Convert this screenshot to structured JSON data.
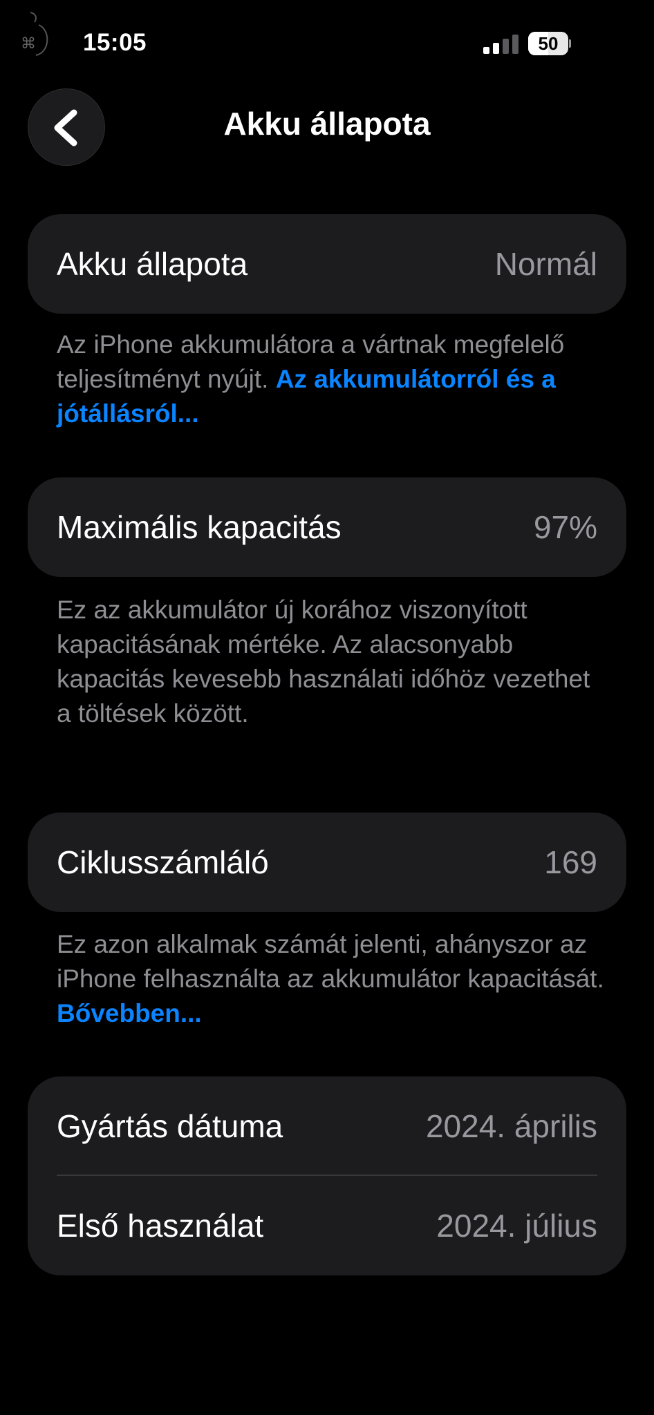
{
  "status_bar": {
    "time": "15:05",
    "battery_percent": "50",
    "battery_level": 0.5,
    "signal_bars_active": 2,
    "signal_bars_total": 4
  },
  "header": {
    "back_icon": "chevron-left-icon",
    "title": "Akku állapota"
  },
  "battery_health": {
    "label": "Akku állapota",
    "value": "Normál",
    "description": "Az iPhone akkumulátora a vártnak megfelelő teljesítményt nyújt. ",
    "link": "Az akkumulátorról és a jótállásról..."
  },
  "max_capacity": {
    "label": "Maximális kapacitás",
    "value": "97%",
    "description": "Ez az akkumulátor új korához viszonyított kapacitásának mértéke. Az alacsonyabb kapacitás kevesebb használati időhöz vezethet a töltések között."
  },
  "cycle_count": {
    "label": "Ciklusszámláló",
    "value": "169",
    "description": "Ez azon alkalmak számát jelenti, ahányszor az iPhone felhasználta az akkumulátor kapacitását. ",
    "link": "Bővebben..."
  },
  "dates": {
    "manufacture_label": "Gyártás dátuma",
    "manufacture_value": "2024. április",
    "first_use_label": "Első használat",
    "first_use_value": "2024. július"
  },
  "colors": {
    "background": "#000000",
    "card": "#1c1c1e",
    "secondary_text": "#98989f",
    "link": "#0a84ff"
  }
}
